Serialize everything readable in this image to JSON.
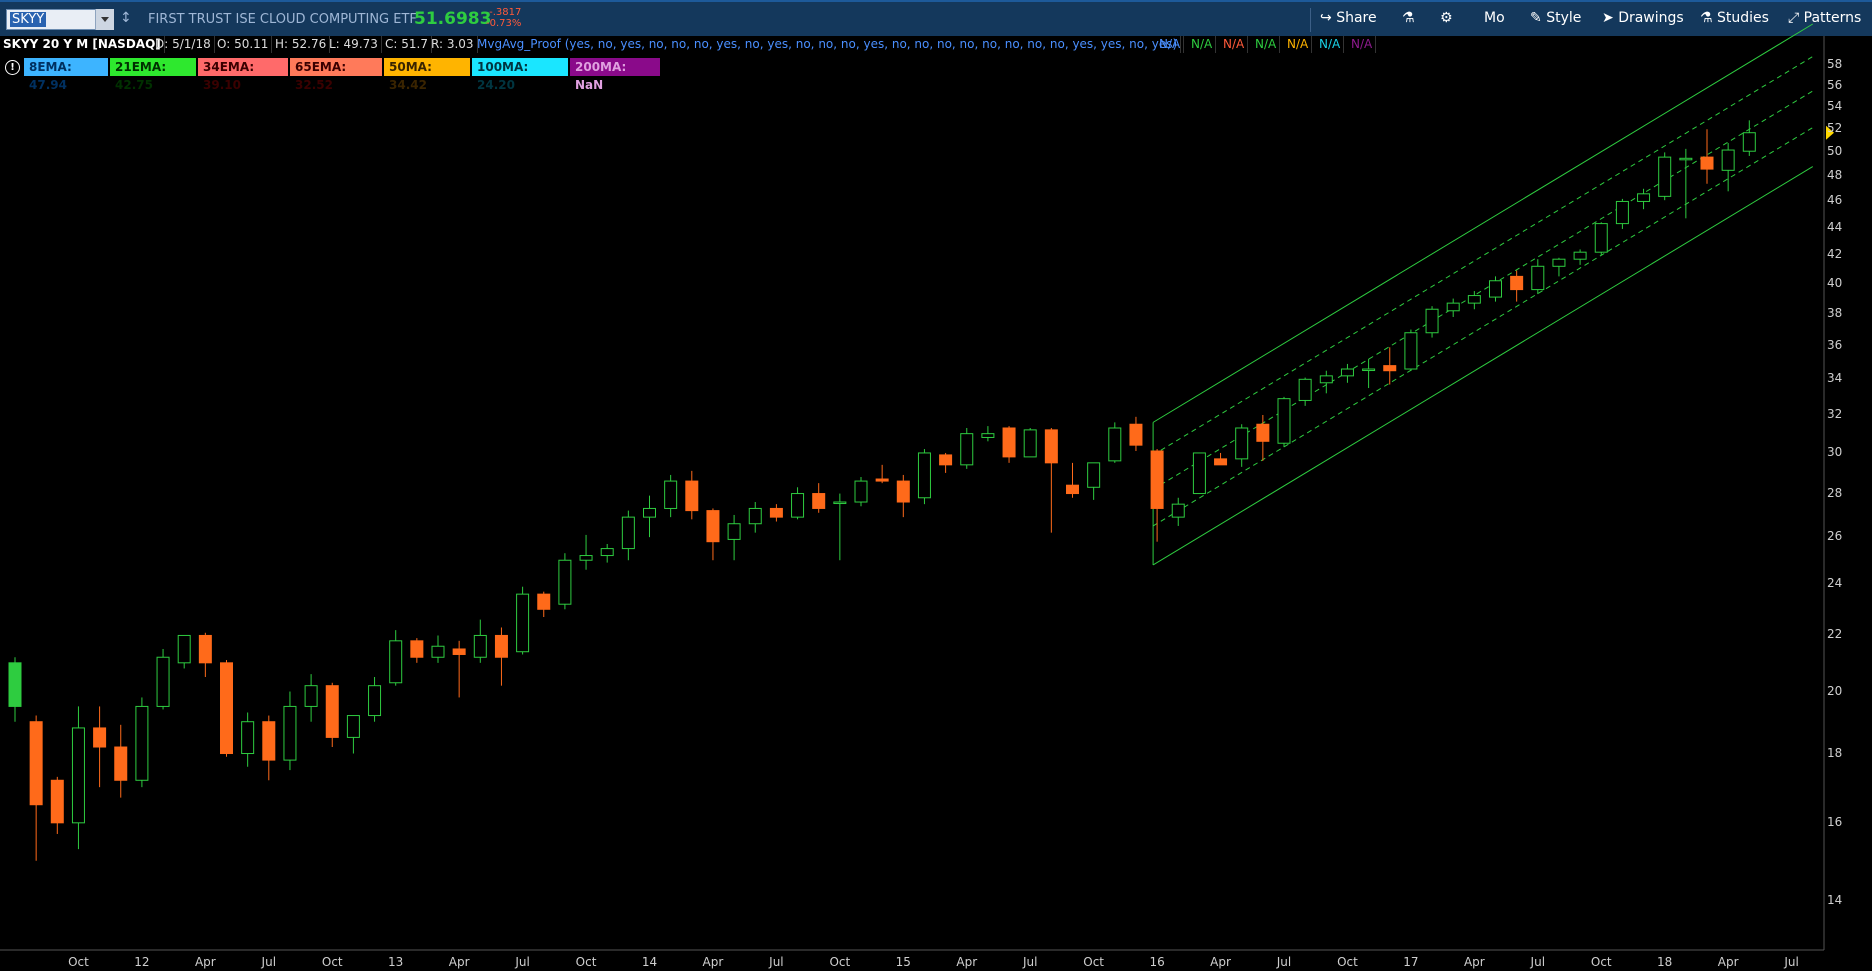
{
  "toolbar": {
    "symbol": "SKYY",
    "company": "FIRST TRUST ISE CLOUD COMPUTING ETF",
    "price": "51.6983",
    "change_abs": "-.3817",
    "change_pct": "-0.73%",
    "share_label": "Share",
    "timeframe_label": "Mo",
    "style_label": "Style",
    "drawings_label": "Drawings",
    "studies_label": "Studies",
    "patterns_label": "Patterns",
    "icons": [
      "link-icon",
      "share-icon",
      "flask-icon",
      "gear-icon",
      "style-icon",
      "drawings-icon",
      "studies-icon",
      "patterns-icon"
    ]
  },
  "info": {
    "title": "SKYY 20 Y M [NASDAQ]",
    "date": "D: 5/1/18",
    "open": "O: 50.11",
    "high": "H: 52.76",
    "low": "L: 49.73",
    "close": "C: 51.7",
    "range": "R: 3.03",
    "study": "MvgAvg_Proof (yes, no, yes, no, no, no, yes, no, yes, no, no, no, yes, no, no, no, no, no, no, no, no, yes, yes, no, yes)",
    "na_values": [
      {
        "text": "N/A",
        "color": "#4a8fff"
      },
      {
        "text": "N/A",
        "color": "#2ecc40"
      },
      {
        "text": "N/A",
        "color": "#ff5a3a"
      },
      {
        "text": "N/A",
        "color": "#2ecc40"
      },
      {
        "text": "N/A",
        "color": "#ffb400"
      },
      {
        "text": "N/A",
        "color": "#1ad1e6"
      },
      {
        "text": "N/A",
        "color": "#8e1a8e"
      }
    ]
  },
  "studies": [
    {
      "label": "8EMA: 47.94",
      "bg": "#3db4ff",
      "fg": "#003060"
    },
    {
      "label": "21EMA: 42.75",
      "bg": "#2ee82e",
      "fg": "#003000"
    },
    {
      "label": "34EMA: 39.10",
      "bg": "#ff6a6a",
      "fg": "#3a0000"
    },
    {
      "label": "65EMA: 32.52",
      "bg": "#ff7a5a",
      "fg": "#3a0000"
    },
    {
      "label": "50MA: 34.42",
      "bg": "#ffb400",
      "fg": "#3a2400"
    },
    {
      "label": "100MA: 24.20",
      "bg": "#1ae6ff",
      "fg": "#003540"
    },
    {
      "label": "200MA: NaN",
      "bg": "#8a0a8a",
      "fg": "#e0a0e0"
    }
  ],
  "colors": {
    "up": "#2ecc40",
    "down": "#ff6a1a",
    "channel": "#2ecc40",
    "price_marker": "#ffd800"
  },
  "chart_data": {
    "type": "candlestick",
    "ylim": [
      13,
      59
    ],
    "y_ticks": [
      14,
      16,
      18,
      20,
      22,
      24,
      26,
      28,
      30,
      32,
      34,
      36,
      38,
      40,
      42,
      44,
      46,
      48,
      50,
      52,
      54,
      56,
      58
    ],
    "x_labels": [
      {
        "label": "Oct",
        "index": 3
      },
      {
        "label": "12",
        "index": 6
      },
      {
        "label": "Apr",
        "index": 9
      },
      {
        "label": "Jul",
        "index": 12
      },
      {
        "label": "Oct",
        "index": 15
      },
      {
        "label": "13",
        "index": 18
      },
      {
        "label": "Apr",
        "index": 21
      },
      {
        "label": "Jul",
        "index": 24
      },
      {
        "label": "Oct",
        "index": 27
      },
      {
        "label": "14",
        "index": 30
      },
      {
        "label": "Apr",
        "index": 33
      },
      {
        "label": "Jul",
        "index": 36
      },
      {
        "label": "Oct",
        "index": 39
      },
      {
        "label": "15",
        "index": 42
      },
      {
        "label": "Apr",
        "index": 45
      },
      {
        "label": "Jul",
        "index": 48
      },
      {
        "label": "Oct",
        "index": 51
      },
      {
        "label": "16",
        "index": 54
      },
      {
        "label": "Apr",
        "index": 57
      },
      {
        "label": "Jul",
        "index": 60
      },
      {
        "label": "Oct",
        "index": 63
      },
      {
        "label": "17",
        "index": 66
      },
      {
        "label": "Apr",
        "index": 69
      },
      {
        "label": "Jul",
        "index": 72
      },
      {
        "label": "Oct",
        "index": 75
      },
      {
        "label": "18",
        "index": 78
      },
      {
        "label": "Apr",
        "index": 81
      },
      {
        "label": "Jul",
        "index": 84
      }
    ],
    "ohlc": [
      [
        19.5,
        21.2,
        19.0,
        21.0
      ],
      [
        19.0,
        19.2,
        15.0,
        16.5
      ],
      [
        17.2,
        17.3,
        15.7,
        16.0
      ],
      [
        16.0,
        19.5,
        15.3,
        18.8
      ],
      [
        18.8,
        19.5,
        17.0,
        18.2
      ],
      [
        18.2,
        18.9,
        16.7,
        17.2
      ],
      [
        17.2,
        19.8,
        17.0,
        19.5
      ],
      [
        19.5,
        21.5,
        19.4,
        21.2
      ],
      [
        21.0,
        21.9,
        20.8,
        22.0
      ],
      [
        22.0,
        22.1,
        20.5,
        21.0
      ],
      [
        21.0,
        21.1,
        17.9,
        18.0
      ],
      [
        18.0,
        19.3,
        17.6,
        19.0
      ],
      [
        19.0,
        19.2,
        17.2,
        17.8
      ],
      [
        17.8,
        20.0,
        17.5,
        19.5
      ],
      [
        19.5,
        20.6,
        19.0,
        20.2
      ],
      [
        20.2,
        20.3,
        18.2,
        18.5
      ],
      [
        18.5,
        19.2,
        18.0,
        19.2
      ],
      [
        19.2,
        20.5,
        19.0,
        20.2
      ],
      [
        20.3,
        22.2,
        20.2,
        21.8
      ],
      [
        21.8,
        21.9,
        21.0,
        21.2
      ],
      [
        21.2,
        22.0,
        21.0,
        21.6
      ],
      [
        21.5,
        21.8,
        19.8,
        21.3
      ],
      [
        21.2,
        22.6,
        21.0,
        22.0
      ],
      [
        22.0,
        22.3,
        20.2,
        21.2
      ],
      [
        21.4,
        23.9,
        21.3,
        23.6
      ],
      [
        23.6,
        23.7,
        22.7,
        23.0
      ],
      [
        23.2,
        25.3,
        23.0,
        25.0
      ],
      [
        25.0,
        26.1,
        24.6,
        25.2
      ],
      [
        25.2,
        25.7,
        24.9,
        25.5
      ],
      [
        25.5,
        27.2,
        25.0,
        26.9
      ],
      [
        26.9,
        27.9,
        26.0,
        27.3
      ],
      [
        27.3,
        28.9,
        26.9,
        28.6
      ],
      [
        28.6,
        29.1,
        26.8,
        27.2
      ],
      [
        27.2,
        27.3,
        25.0,
        25.8
      ],
      [
        25.9,
        27.0,
        25.0,
        26.6
      ],
      [
        26.6,
        27.6,
        26.2,
        27.3
      ],
      [
        27.3,
        27.5,
        26.7,
        26.9
      ],
      [
        26.9,
        28.3,
        26.8,
        28.0
      ],
      [
        28.0,
        28.5,
        27.1,
        27.3
      ],
      [
        27.6,
        28.0,
        25.0,
        27.6
      ],
      [
        27.6,
        28.8,
        27.4,
        28.6
      ],
      [
        28.7,
        29.4,
        28.5,
        28.6
      ],
      [
        28.6,
        28.9,
        26.9,
        27.6
      ],
      [
        27.8,
        30.2,
        27.5,
        30.0
      ],
      [
        29.9,
        30.0,
        29.0,
        29.4
      ],
      [
        29.4,
        31.3,
        29.2,
        31.0
      ],
      [
        30.8,
        31.4,
        30.6,
        31.0
      ],
      [
        31.3,
        31.4,
        29.5,
        29.8
      ],
      [
        29.8,
        31.3,
        29.8,
        31.2
      ],
      [
        31.2,
        31.3,
        26.2,
        29.5
      ],
      [
        28.4,
        29.5,
        27.8,
        28.0
      ],
      [
        28.3,
        29.2,
        27.7,
        29.5
      ],
      [
        29.6,
        31.6,
        29.5,
        31.3
      ],
      [
        31.5,
        31.9,
        30.1,
        30.4
      ],
      [
        30.1,
        30.2,
        25.8,
        27.3
      ],
      [
        26.9,
        27.8,
        26.5,
        27.5
      ],
      [
        28.0,
        30.0,
        28.0,
        30.0
      ],
      [
        29.7,
        30.0,
        29.4,
        29.4
      ],
      [
        29.7,
        31.5,
        29.3,
        31.3
      ],
      [
        31.5,
        32.0,
        29.6,
        30.6
      ],
      [
        30.5,
        33.0,
        30.3,
        32.9
      ],
      [
        32.8,
        34.1,
        32.5,
        34.0
      ],
      [
        33.8,
        34.5,
        33.2,
        34.2
      ],
      [
        34.2,
        34.9,
        33.8,
        34.6
      ],
      [
        34.6,
        35.2,
        33.5,
        34.6
      ],
      [
        34.8,
        35.9,
        33.7,
        34.5
      ],
      [
        34.6,
        37.0,
        34.5,
        36.8
      ],
      [
        36.8,
        38.5,
        36.5,
        38.3
      ],
      [
        38.2,
        39.0,
        37.8,
        38.7
      ],
      [
        38.7,
        39.5,
        38.3,
        39.2
      ],
      [
        39.1,
        40.5,
        38.8,
        40.2
      ],
      [
        40.5,
        40.9,
        38.8,
        39.6
      ],
      [
        39.6,
        41.7,
        39.3,
        41.2
      ],
      [
        41.2,
        41.8,
        40.5,
        41.7
      ],
      [
        41.7,
        42.4,
        41.3,
        42.2
      ],
      [
        42.2,
        44.4,
        42.0,
        44.3
      ],
      [
        44.3,
        46.2,
        43.9,
        46.0
      ],
      [
        46.0,
        47.0,
        45.4,
        46.6
      ],
      [
        46.4,
        50.0,
        46.1,
        49.6
      ],
      [
        49.4,
        50.3,
        44.7,
        49.5
      ],
      [
        49.6,
        52.0,
        47.4,
        48.6
      ],
      [
        48.5,
        50.8,
        46.8,
        50.2
      ],
      [
        50.1,
        52.8,
        49.7,
        51.7
      ]
    ],
    "channel": {
      "start_index": 54,
      "end_index": 85,
      "start_price": 28.2,
      "end_price": 55.5,
      "upper_offset": 3.4,
      "lower_offset": -3.4,
      "inner_offset": 1.7
    }
  }
}
